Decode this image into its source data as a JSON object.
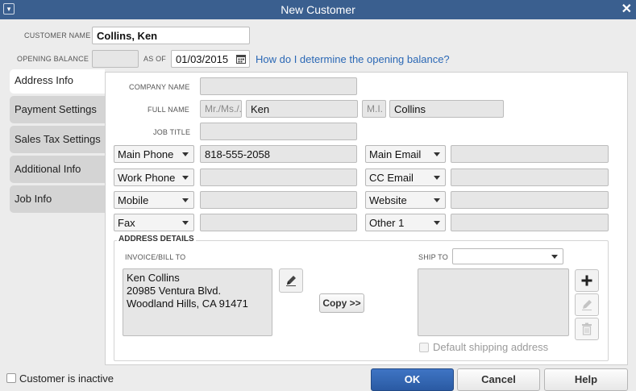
{
  "window": {
    "title": "New Customer"
  },
  "header": {
    "customer_name_label": "CUSTOMER NAME",
    "customer_name_value": "Collins, Ken",
    "opening_balance_label": "OPENING BALANCE",
    "opening_balance_value": "",
    "as_of_label": "AS OF",
    "as_of_value": "01/03/2015",
    "help_link": "How do I determine the opening balance?"
  },
  "tabs": [
    {
      "label": "Address Info",
      "active": true
    },
    {
      "label": "Payment Settings",
      "active": false
    },
    {
      "label": "Sales Tax Settings",
      "active": false
    },
    {
      "label": "Additional Info",
      "active": false
    },
    {
      "label": "Job Info",
      "active": false
    }
  ],
  "form": {
    "company_name_label": "COMPANY NAME",
    "company_name_value": "",
    "full_name_label": "FULL NAME",
    "title_placeholder": "Mr./Ms./...",
    "first_name_value": "Ken",
    "middle_initial_placeholder": "M.I.",
    "last_name_value": "Collins",
    "job_title_label": "JOB TITLE",
    "job_title_value": "",
    "contacts_left": [
      {
        "type": "Main Phone",
        "value": "818-555-2058"
      },
      {
        "type": "Work Phone",
        "value": ""
      },
      {
        "type": "Mobile",
        "value": ""
      },
      {
        "type": "Fax",
        "value": ""
      }
    ],
    "contacts_right": [
      {
        "type": "Main Email",
        "value": ""
      },
      {
        "type": "CC Email",
        "value": ""
      },
      {
        "type": "Website",
        "value": ""
      },
      {
        "type": "Other 1",
        "value": ""
      }
    ]
  },
  "address": {
    "section_label": "ADDRESS DETAILS",
    "bill_to_label": "INVOICE/BILL TO",
    "bill_to_lines": [
      "Ken Collins",
      "20985 Ventura Blvd.",
      "Woodland Hills, CA 91471"
    ],
    "copy_button": "Copy >>",
    "ship_to_label": "SHIP TO",
    "ship_to_selected": "",
    "default_shipping_label": "Default shipping address"
  },
  "footer": {
    "inactive_label": "Customer is inactive",
    "ok_label": "OK",
    "cancel_label": "Cancel",
    "help_label": "Help"
  },
  "colors": {
    "titlebar": "#3a5f8f",
    "link": "#2b68b5",
    "ok_button": "#2f64b3"
  }
}
